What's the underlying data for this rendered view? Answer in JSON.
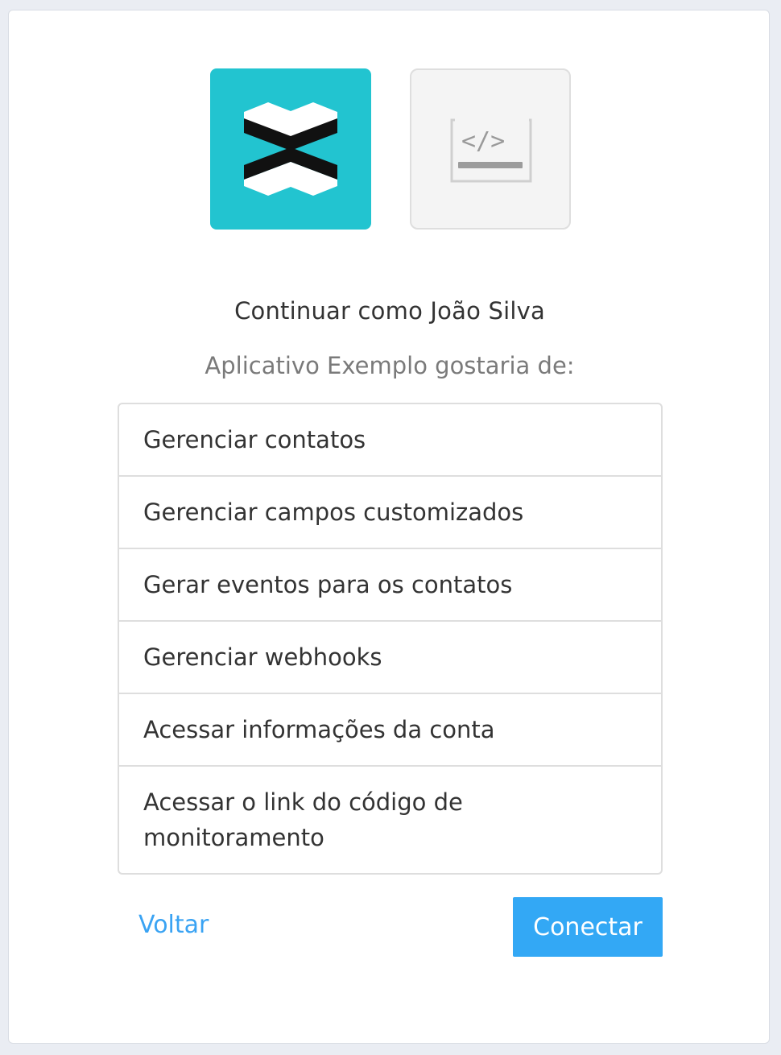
{
  "logos": {
    "brand_icon": "brand-chevrons-icon",
    "brand_color": "#22c4d0",
    "app_icon": "code-window-icon"
  },
  "header": {
    "continue_as": "Continuar como João Silva",
    "subtitle": "Aplicativo Exemplo gostaria de:"
  },
  "permissions": [
    "Gerenciar contatos",
    "Gerenciar campos customizados",
    "Gerar eventos para os contatos",
    "Gerenciar webhooks",
    "Acessar informações da conta",
    "Acessar o link do código de monitoramento"
  ],
  "actions": {
    "back_label": "Voltar",
    "connect_label": "Conectar",
    "accent_color": "#33a8f5"
  }
}
